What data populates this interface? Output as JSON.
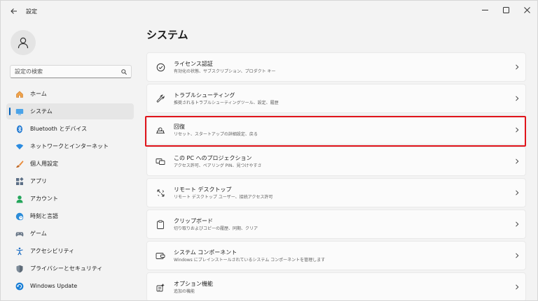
{
  "titlebar": {
    "title": "設定"
  },
  "sidebar": {
    "search_placeholder": "設定の検索",
    "items": [
      {
        "label": "ホーム",
        "icon": "home-icon"
      },
      {
        "label": "システム",
        "icon": "monitor-icon",
        "selected": true
      },
      {
        "label": "Bluetooth とデバイス",
        "icon": "bluetooth-icon"
      },
      {
        "label": "ネットワークとインターネット",
        "icon": "wifi-icon"
      },
      {
        "label": "個人用設定",
        "icon": "brush-icon"
      },
      {
        "label": "アプリ",
        "icon": "apps-icon"
      },
      {
        "label": "アカウント",
        "icon": "person-icon"
      },
      {
        "label": "時刻と言語",
        "icon": "globe-clock-icon"
      },
      {
        "label": "ゲーム",
        "icon": "gamepad-icon"
      },
      {
        "label": "アクセシビリティ",
        "icon": "accessibility-icon"
      },
      {
        "label": "プライバシーとセキュリティ",
        "icon": "shield-icon"
      },
      {
        "label": "Windows Update",
        "icon": "update-icon"
      }
    ]
  },
  "main": {
    "title": "システム",
    "cards": [
      {
        "title": "ライセンス認証",
        "desc": "有効化の状態、サブスクリプション、プロダクト キー",
        "icon": "check-circle-icon"
      },
      {
        "title": "トラブルシューティング",
        "desc": "推奨されるトラブルシューティングツール、設定、履歴",
        "icon": "wrench-icon"
      },
      {
        "title": "回復",
        "desc": "リセット、スタートアップの詳細設定、戻る",
        "icon": "recovery-icon"
      },
      {
        "title": "この PC へのプロジェクション",
        "desc": "アクセス許可、ペアリング PIN、見つけやすさ",
        "icon": "projection-icon"
      },
      {
        "title": "リモート デスクトップ",
        "desc": "リモート デスクトップ ユーザー、接続アクセス許可",
        "icon": "remote-desktop-icon"
      },
      {
        "title": "クリップボード",
        "desc": "切り取りおよびコピーの履歴、同期、クリア",
        "icon": "clipboard-icon"
      },
      {
        "title": "システム コンポーネント",
        "desc": "Windows にプレインストールされているシステム コンポーネントを管理します",
        "icon": "components-icon"
      },
      {
        "title": "オプション機能",
        "desc": "追加の機能",
        "icon": "optional-features-icon"
      }
    ]
  },
  "colors": {
    "accent": "#005fb8",
    "highlight": "#e0131a"
  }
}
